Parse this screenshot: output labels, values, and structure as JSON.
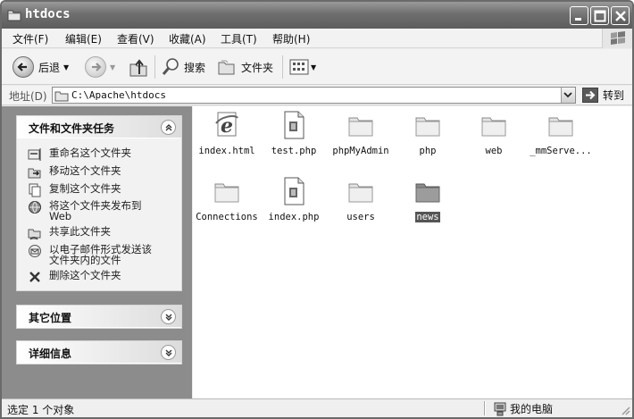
{
  "window": {
    "title": "htdocs"
  },
  "menu": [
    {
      "label": "文件(F)"
    },
    {
      "label": "编辑(E)"
    },
    {
      "label": "查看(V)"
    },
    {
      "label": "收藏(A)"
    },
    {
      "label": "工具(T)"
    },
    {
      "label": "帮助(H)"
    }
  ],
  "toolbar": {
    "back_label": "后退",
    "search_label": "搜索",
    "folders_label": "文件夹"
  },
  "address": {
    "label": "地址(D)",
    "path": "C:\\Apache\\htdocs",
    "go_label": "转到"
  },
  "tasks_panel": {
    "title": "文件和文件夹任务",
    "items": [
      {
        "label": "重命名这个文件夹",
        "icon": "rename-icon"
      },
      {
        "label": "移动这个文件夹",
        "icon": "move-icon"
      },
      {
        "label": "复制这个文件夹",
        "icon": "copy-icon"
      },
      {
        "label": "将这个文件夹发布到",
        "label2": "Web",
        "icon": "publish-web-icon"
      },
      {
        "label": "共享此文件夹",
        "icon": "share-icon"
      },
      {
        "label": "以电子邮件形式发送该",
        "label2": "文件夹内的文件",
        "icon": "email-icon"
      },
      {
        "label": "删除这个文件夹",
        "icon": "delete-icon"
      }
    ]
  },
  "other_places_panel": {
    "title": "其它位置"
  },
  "details_panel": {
    "title": "详细信息"
  },
  "files": [
    {
      "name": "index.html",
      "type": "html"
    },
    {
      "name": "test.php",
      "type": "file"
    },
    {
      "name": "phpMyAdmin",
      "type": "folder"
    },
    {
      "name": "php",
      "type": "folder"
    },
    {
      "name": "web",
      "type": "folder"
    },
    {
      "name": "_mmServe...",
      "type": "folder"
    },
    {
      "name": "Connections",
      "type": "folder"
    },
    {
      "name": "index.php",
      "type": "file"
    },
    {
      "name": "users",
      "type": "folder"
    },
    {
      "name": "news",
      "type": "folder",
      "selected": true
    }
  ],
  "status": {
    "left": "选定 1 个对象",
    "right": "我的电脑"
  }
}
